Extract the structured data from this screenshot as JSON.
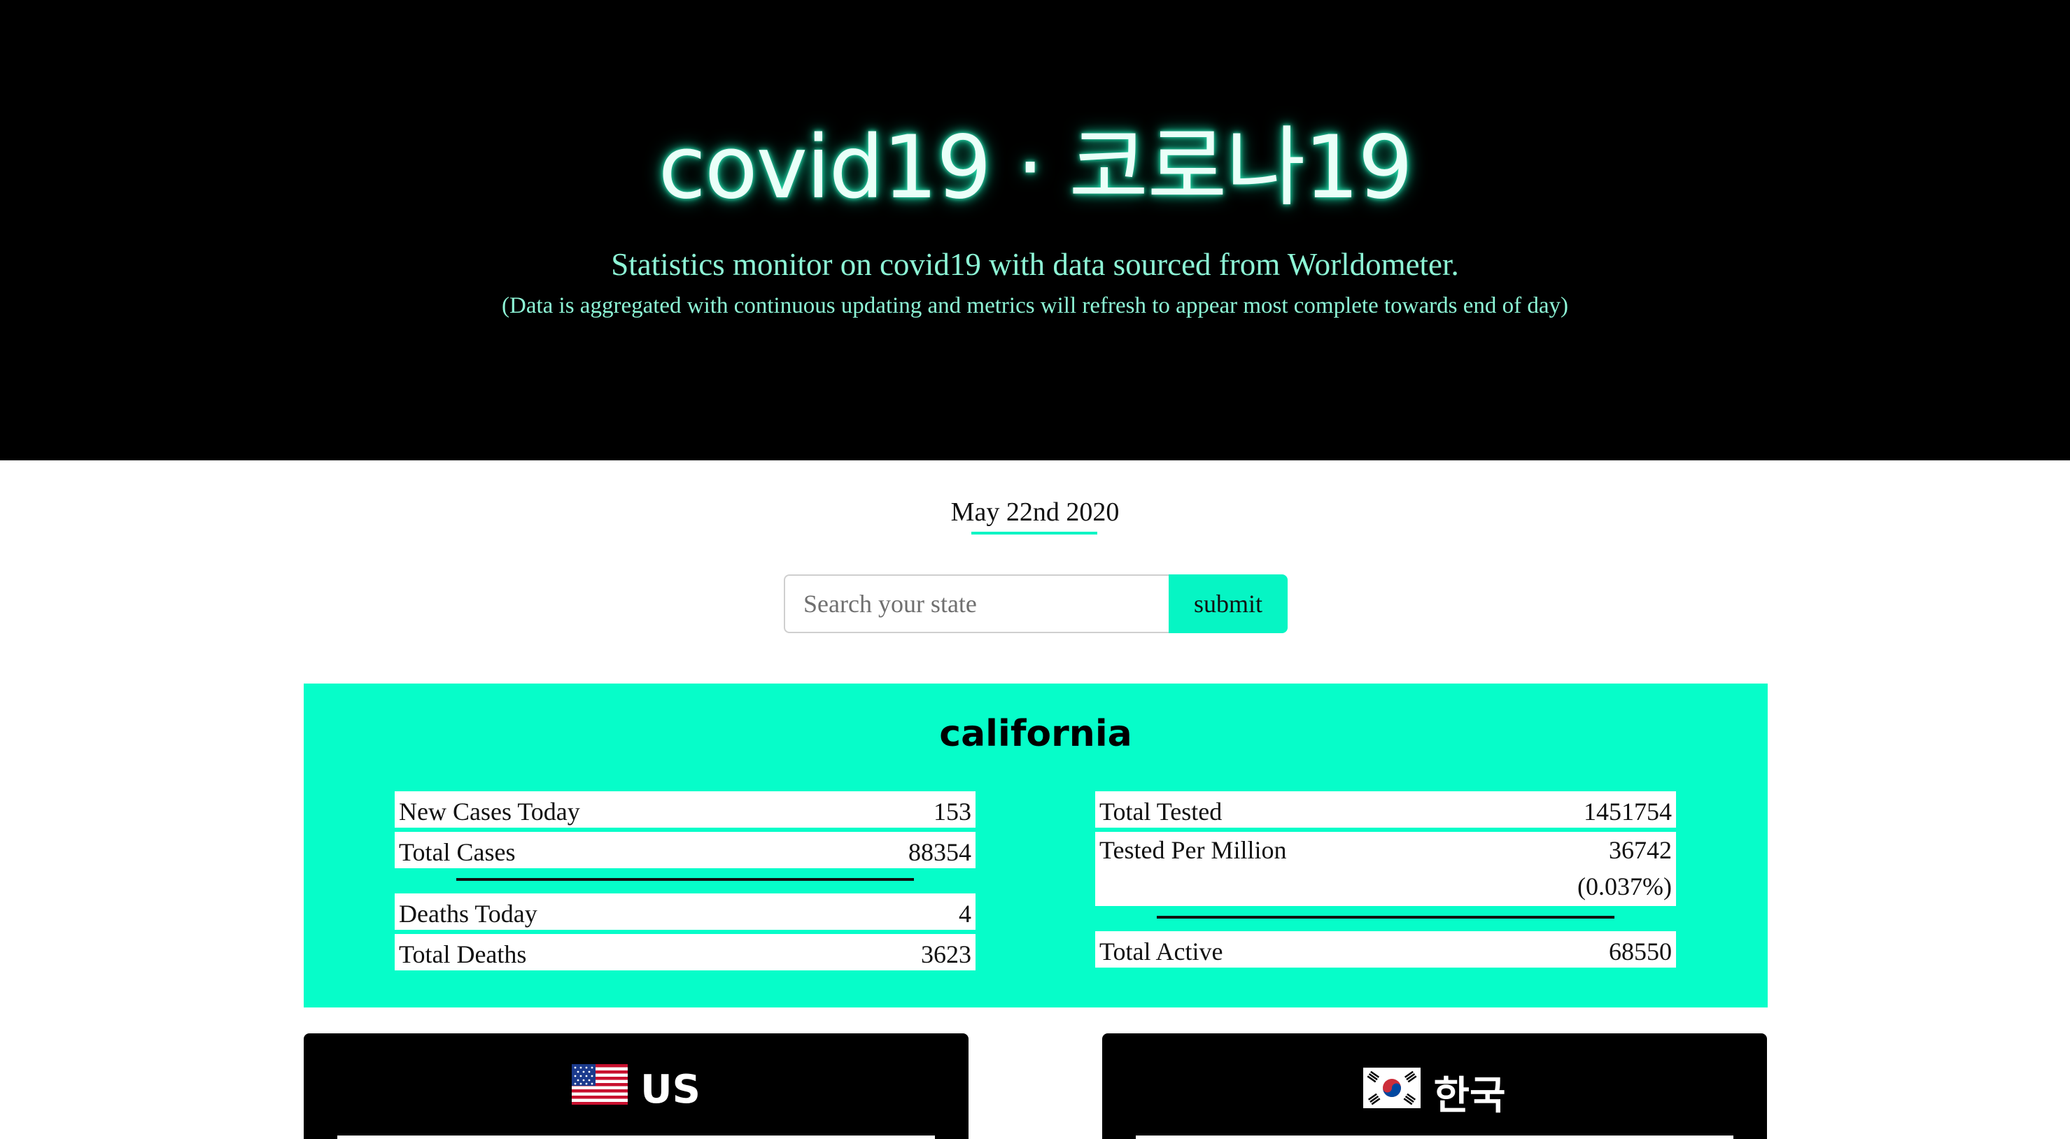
{
  "header": {
    "title": "covid19 · 코로나19",
    "subtitle": "Statistics monitor on covid19 with data sourced from Worldometer.",
    "note": "(Data is aggregated with continuous updating and metrics will refresh to appear most complete towards end of day)"
  },
  "date": "May 22nd 2020",
  "search": {
    "placeholder": "Search your state",
    "submit_label": "submit"
  },
  "state": {
    "name": "california",
    "left_top": [
      {
        "label": "New Cases Today",
        "value": "153"
      },
      {
        "label": "Total Cases",
        "value": "88354"
      }
    ],
    "left_bottom": [
      {
        "label": "Deaths Today",
        "value": "4"
      },
      {
        "label": "Total Deaths",
        "value": "3623"
      }
    ],
    "right_top": [
      {
        "label": "Total Tested",
        "value": "1451754"
      },
      {
        "label": "Tested Per Million",
        "value": "36742",
        "sub": "(0.037%)"
      }
    ],
    "right_bottom": [
      {
        "label": "Total Active",
        "value": "68550"
      }
    ]
  },
  "countries": [
    {
      "name": "US",
      "flag_icon": "us-flag-icon"
    },
    {
      "name": "한국",
      "flag_icon": "kr-flag-icon"
    }
  ],
  "colors": {
    "accent": "#06fdc9",
    "hero_bg": "#000000",
    "hero_text": "#8df5d6"
  }
}
